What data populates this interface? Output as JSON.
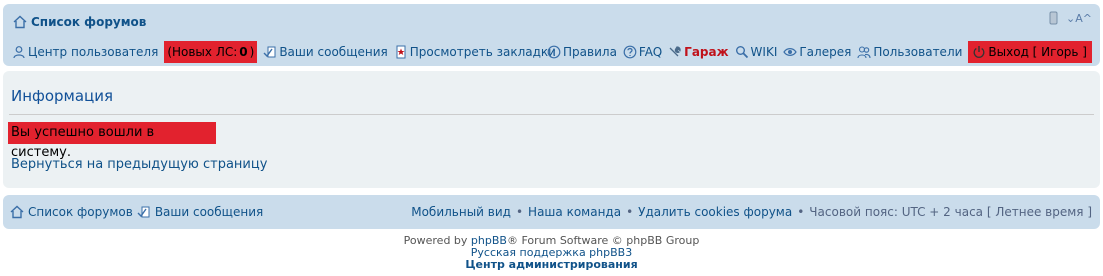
{
  "header": {
    "forum_index": "Список форумов",
    "font_tools": "A^"
  },
  "nav_left": {
    "ucp": "Центр пользователя",
    "new_pm": "(Новых ЛС: ",
    "new_pm_count": "0",
    "new_pm_close": ")",
    "your_posts": "Ваши сообщения",
    "bookmarks": "Просмотреть закладки"
  },
  "nav_right": {
    "rules": "Правила",
    "faq": "FAQ",
    "garage": "Гараж",
    "wiki": "WIKI",
    "gallery": "Галерея",
    "members": "Пользователи",
    "logout": "Выход [ Игорь ]"
  },
  "info": {
    "title": "Информация",
    "message": "Вы успешно вошли в систему.",
    "back_link": "Вернуться на предыдущую страницу"
  },
  "footer": {
    "forum_index": "Список форумов",
    "your_posts": "Ваши сообщения",
    "mobile": "Мобильный вид",
    "team": "Наша команда",
    "delete_cookies": "Удалить cookies форума",
    "timezone": "Часовой пояс: UTC + 2 часа [ Летнее время ]"
  },
  "copyright": {
    "powered_prefix": "Powered by ",
    "phpbb": "phpBB",
    "powered_suffix": "® Forum Software © phpBB Group",
    "russian_support": "Русская поддержка phpBB3",
    "acp": "Центр администрирования"
  }
}
